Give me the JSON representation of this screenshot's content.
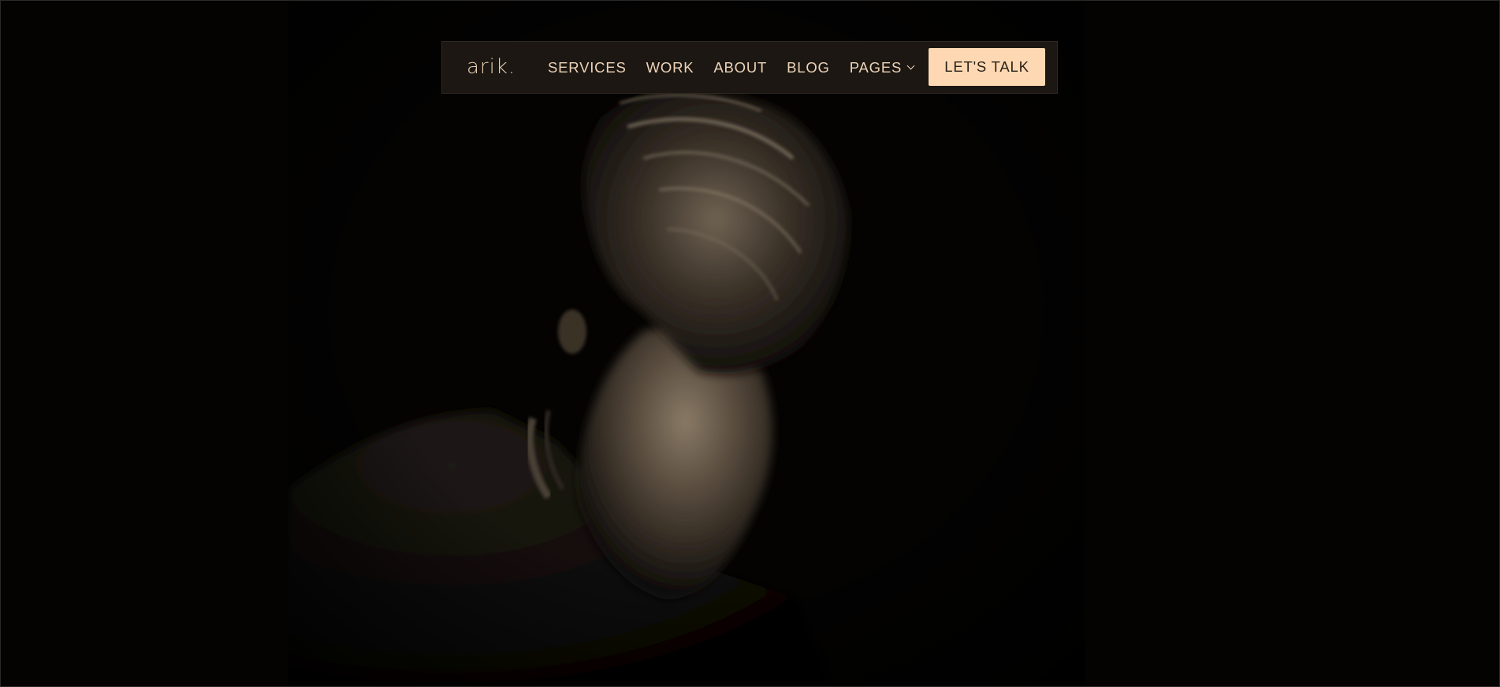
{
  "header": {
    "logo": "arik.",
    "nav": [
      {
        "label": "SERVICES"
      },
      {
        "label": "WORK"
      },
      {
        "label": "ABOUT"
      },
      {
        "label": "BLOG"
      },
      {
        "label": "PAGES",
        "icon": "chevron-down-icon"
      }
    ],
    "cta_label": "LET'S TALK"
  },
  "colors": {
    "background": "#040302",
    "nav_background": "#1c1712",
    "nav_text": "#ecd3b8",
    "cta_background": "#fdd8b2",
    "cta_text": "#2a2118"
  }
}
